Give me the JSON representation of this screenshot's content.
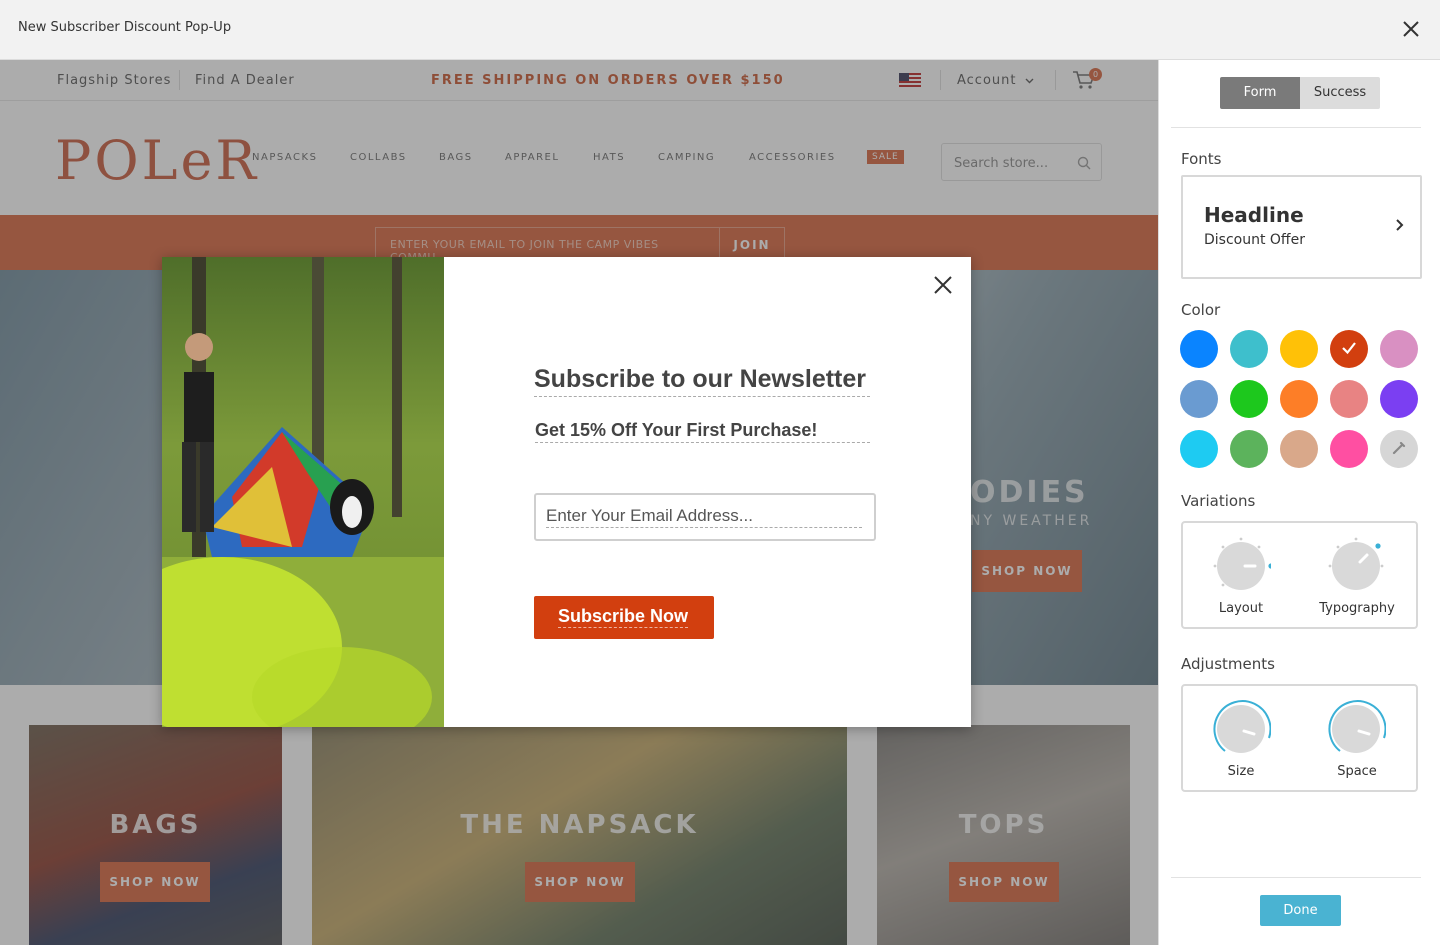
{
  "titlebar": {
    "title": "New Subscriber Discount Pop-Up"
  },
  "site": {
    "topbar": {
      "flagship": "Flagship Stores",
      "dealer": "Find A Dealer",
      "shipping": "FREE SHIPPING ON ORDERS OVER $150",
      "account": "Account",
      "cart_count": "0"
    },
    "logo": "POLeR",
    "nav": [
      "NAPSACKS",
      "COLLABS",
      "BAGS",
      "APPAREL",
      "HATS",
      "CAMPING",
      "ACCESSORIES"
    ],
    "sale": "SALE",
    "search_placeholder": "Search store...",
    "promo": {
      "email_placeholder": "ENTER YOUR EMAIL TO JOIN THE CAMP VIBES COMMU",
      "join": "JOIN"
    },
    "hero": {
      "title": "ODIES",
      "subtitle": "NY WEATHER",
      "button": "SHOP NOW"
    },
    "tiles": [
      {
        "title": "BAGS",
        "button": "SHOP NOW"
      },
      {
        "title": "THE NAPSACK",
        "button": "SHOP NOW"
      },
      {
        "title": "TOPS",
        "button": "SHOP NOW"
      }
    ]
  },
  "popup": {
    "headline": "Subscribe to our Newsletter",
    "subheadline": "Get 15% Off Your First Purchase!",
    "email_placeholder": "Enter Your Email Address...",
    "button": "Subscribe Now"
  },
  "panel": {
    "tabs": {
      "form": "Form",
      "success": "Success"
    },
    "fonts_label": "Fonts",
    "font_card": {
      "headline": "Headline",
      "sub": "Discount Offer"
    },
    "color_label": "Color",
    "colors": [
      "#0a84ff",
      "#3ebfcc",
      "#ffc107",
      "#d23f0f",
      "#d990c2",
      "#6a9bd1",
      "#1dc81d",
      "#fd7e27",
      "#e88383",
      "#7b3ff2",
      "#1ecbf2",
      "#5cb35c",
      "#d9a88a",
      "#ff4fa2",
      "#d6d6d6"
    ],
    "selected_color": "#d23f0f",
    "variations_label": "Variations",
    "variations": [
      "Layout",
      "Typography"
    ],
    "adjustments_label": "Adjustments",
    "adjustments": [
      "Size",
      "Space"
    ],
    "done": "Done"
  }
}
